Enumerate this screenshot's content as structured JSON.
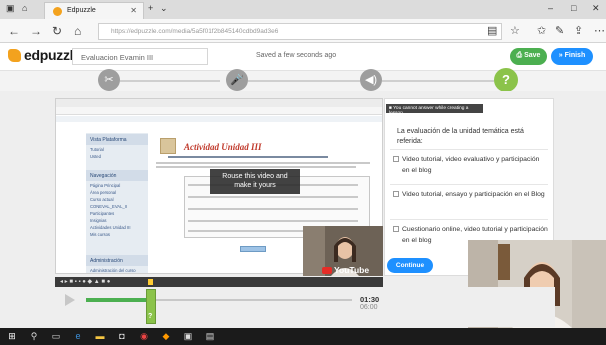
{
  "browser": {
    "tab_title": "Edpuzzle",
    "url": "https://edpuzzle.com/media/5a5f01f2b845140cdbd9ad3e6",
    "icons": [
      "back-icon",
      "forward-icon",
      "refresh-icon",
      "home-icon",
      "star-icon",
      "favorites-icon",
      "pen-icon",
      "share-icon",
      "more-icon"
    ]
  },
  "header": {
    "logo_text": "edpuzzle",
    "title_value": "Evaluacion Evamin III",
    "saved_status": "Saved a few seconds ago",
    "save_label": "Save",
    "finish_label": "Finish"
  },
  "video": {
    "inner_page": {
      "left_sections": [
        {
          "heading": "Vista Plataforma",
          "items": [
            "Tutorial",
            "Usted"
          ]
        },
        {
          "heading": "Navegación",
          "items": [
            "Página Principal",
            "Área personal",
            "Curso actual",
            "CONEVAL_EVAL_II",
            "Participantes",
            "Insignias",
            "Actividades Unidad III",
            "Mis cursos"
          ]
        },
        {
          "heading": "Administración",
          "items": [
            "Administración del curso"
          ]
        }
      ],
      "doc_title": "Actividad Unidad III"
    },
    "overlay_text": "Rouse this video and make it yours",
    "youtube_label": "YouTube",
    "current_time": "01:30",
    "total_time": "06:00",
    "progress_fraction": 0.25
  },
  "question_panel": {
    "warning": "You cannot answer while creating a lesson.",
    "question": "La evaluación de la unidad temática está referida:",
    "options": [
      "Video tutorial, video evaluativo y participación en el blog",
      "Video tutorial, ensayo y participación en el Blog",
      "Cuestionario online, video tutorial y participación en el blog"
    ],
    "continue_label": "Continue"
  },
  "colors": {
    "accent_green": "#8bc34a",
    "save_green": "#4caf50",
    "finish_blue": "#1e90ff",
    "continue_blue": "#1e90ff",
    "logo_orange": "#f3a21e"
  }
}
